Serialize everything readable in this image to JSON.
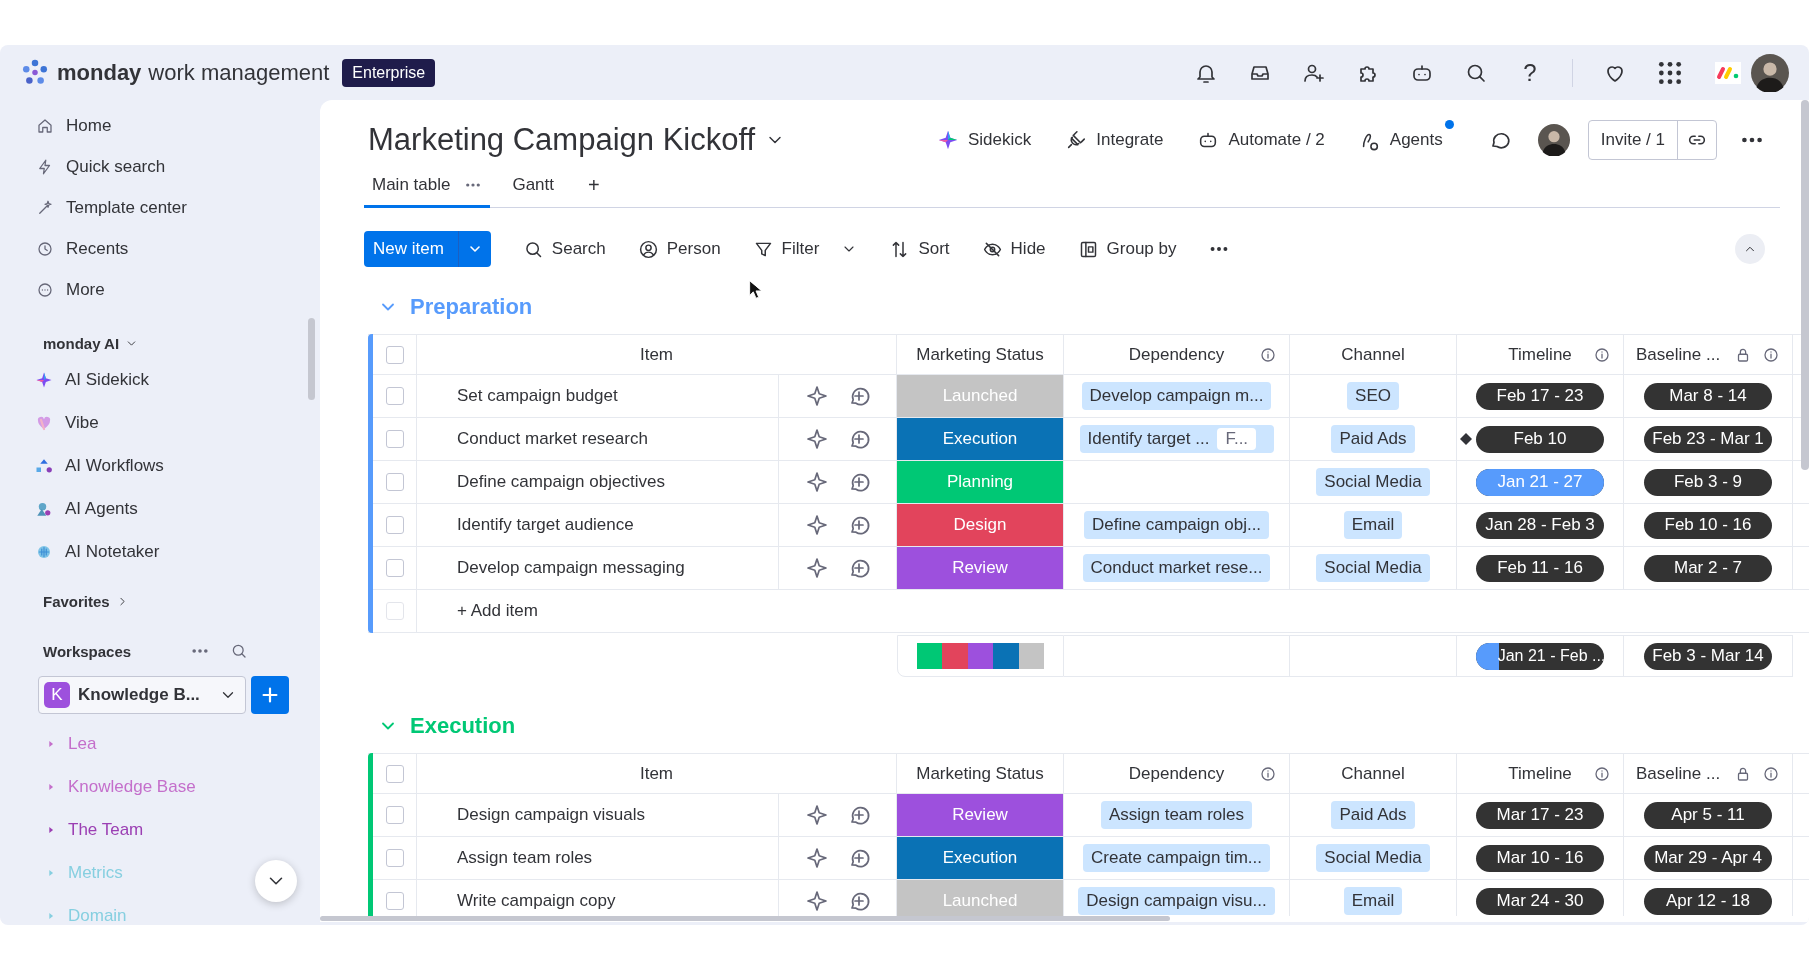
{
  "topbar": {
    "brand": "monday",
    "product": "work management",
    "plan": "Enterprise",
    "help": "?"
  },
  "sidebar": {
    "nav": [
      "Home",
      "Quick search",
      "Template center",
      "Recents",
      "More"
    ],
    "ai_title": "monday AI",
    "ai_items": [
      "AI Sidekick",
      "Vibe",
      "AI Workflows",
      "AI Agents",
      "AI Notetaker"
    ],
    "favorites": "Favorites",
    "workspaces": "Workspaces",
    "workspace": {
      "initial": "K",
      "name": "Knowledge B..."
    },
    "tree": [
      {
        "label": "Lea",
        "color": "#c46fcb"
      },
      {
        "label": "Knowledge Base",
        "color": "#c46fcb"
      },
      {
        "label": "The Team",
        "color": "#9b3fb3"
      },
      {
        "label": "Metrics",
        "color": "#86cfe0"
      },
      {
        "label": "Domain",
        "color": "#86cfe0"
      }
    ]
  },
  "board": {
    "title": "Marketing Campaign Kickoff",
    "actions": [
      "Sidekick",
      "Integrate",
      "Automate / 2",
      "Agents"
    ],
    "invite": "Invite / 1",
    "views": [
      {
        "label": "Main table",
        "selected": true
      },
      {
        "label": "Gantt",
        "selected": false
      }
    ],
    "add_view": "+",
    "new_item": "New item",
    "tools": [
      "Search",
      "Person",
      "Filter",
      "Sort",
      "Hide",
      "Group by"
    ],
    "groups": [
      {
        "name": "Preparation",
        "color": "#579bfc",
        "all_checked": false,
        "columns": [
          "Item",
          "Marketing Status",
          "Dependency",
          "Channel",
          "Timeline",
          "Baseline ..."
        ],
        "rows": [
          {
            "checked": false,
            "item": "Set campaign budget",
            "status": {
              "label": "Launched",
              "color": "#c4c4c4"
            },
            "dependency": [
              "Develop campaign m..."
            ],
            "channel": "SEO",
            "timeline": {
              "label": "Feb 17 - 23",
              "milestone": false
            },
            "baseline": "Mar 8 - 14"
          },
          {
            "checked": false,
            "item": "Conduct market research",
            "status": {
              "label": "Execution",
              "color": "#0a72b5"
            },
            "dependency": [
              "Identify target ...",
              "F..."
            ],
            "channel": "Paid Ads",
            "timeline": {
              "label": "Feb 10",
              "milestone": true
            },
            "baseline": "Feb 23 - Mar 1"
          },
          {
            "checked": false,
            "item": "Define campaign objectives",
            "status": {
              "label": "Planning",
              "color": "#00c875"
            },
            "dependency": [],
            "channel": "Social Media",
            "timeline": {
              "label": "Jan 21 - 27",
              "level": 1,
              "milestone": false
            },
            "baseline": "Feb 3 - 9"
          },
          {
            "checked": false,
            "item": "Identify target audience",
            "status": {
              "label": "Design",
              "color": "#e2445c"
            },
            "dependency": [
              "Define campaign obj..."
            ],
            "channel": "Email",
            "timeline": {
              "label": "Jan 28 - Feb 3",
              "milestone": false
            },
            "baseline": "Feb 10 - 16"
          },
          {
            "checked": false,
            "item": "Develop campaign messaging",
            "status": {
              "label": "Review",
              "color": "#9d50dd"
            },
            "dependency": [
              "Conduct market rese..."
            ],
            "channel": "Social Media",
            "timeline": {
              "label": "Feb 11 - 16",
              "milestone": false
            },
            "baseline": "Mar 2 - 7"
          }
        ],
        "add_row": {
          "label": "+ Add item",
          "checked": false
        },
        "summary": {
          "status_colors": [
            {
              "color": "#00c875"
            },
            {
              "color": "#e2445c"
            },
            {
              "color": "#9d50dd"
            },
            {
              "color": "#0a72b5"
            },
            {
              "color": "#c4c4c4"
            }
          ],
          "timeline": {
            "label": "Jan 21 - Feb ...",
            "level": 0.18
          },
          "baseline": "Feb 3 - Mar 14"
        }
      },
      {
        "name": "Execution",
        "color": "#00c875",
        "all_checked": false,
        "columns": [
          "Item",
          "Marketing Status",
          "Dependency",
          "Channel",
          "Timeline",
          "Baseline ..."
        ],
        "rows": [
          {
            "checked": false,
            "item": "Design campaign visuals",
            "status": {
              "label": "Review",
              "color": "#9d50dd"
            },
            "dependency": [
              "Assign team roles"
            ],
            "channel": "Paid Ads",
            "timeline": {
              "label": "Mar 17 - 23",
              "milestone": false
            },
            "baseline": "Apr 5 - 11"
          },
          {
            "checked": false,
            "item": "Assign team roles",
            "status": {
              "label": "Execution",
              "color": "#0a72b5"
            },
            "dependency": [
              "Create campaign tim..."
            ],
            "channel": "Social Media",
            "timeline": {
              "label": "Mar 10 - 16",
              "milestone": false
            },
            "baseline": "Mar 29 - Apr 4"
          },
          {
            "checked": false,
            "item": "Write campaign copy",
            "status": {
              "label": "Launched",
              "color": "#c4c4c4"
            },
            "dependency": [
              "Design campaign visu..."
            ],
            "channel": "Email",
            "timeline": {
              "label": "Mar 24 - 30",
              "milestone": false
            },
            "baseline": "Apr 12 - 18"
          }
        ]
      }
    ]
  }
}
